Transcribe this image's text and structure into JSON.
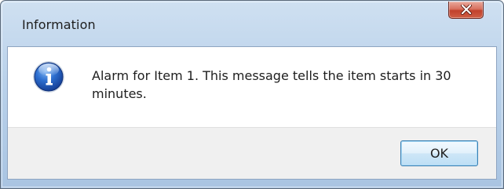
{
  "window": {
    "title": "Information",
    "close_icon": "close-icon"
  },
  "dialog": {
    "icon": "info-icon",
    "message": "Alarm for Item 1. This message tells the item starts in 30 minutes.",
    "ok_label": "OK"
  },
  "colors": {
    "titlebar": "#b9d1ea",
    "close_button": "#c1412c",
    "info_icon": "#1f57b6",
    "button_area": "#f0f0f0",
    "ok_border": "#3c7fb1"
  }
}
